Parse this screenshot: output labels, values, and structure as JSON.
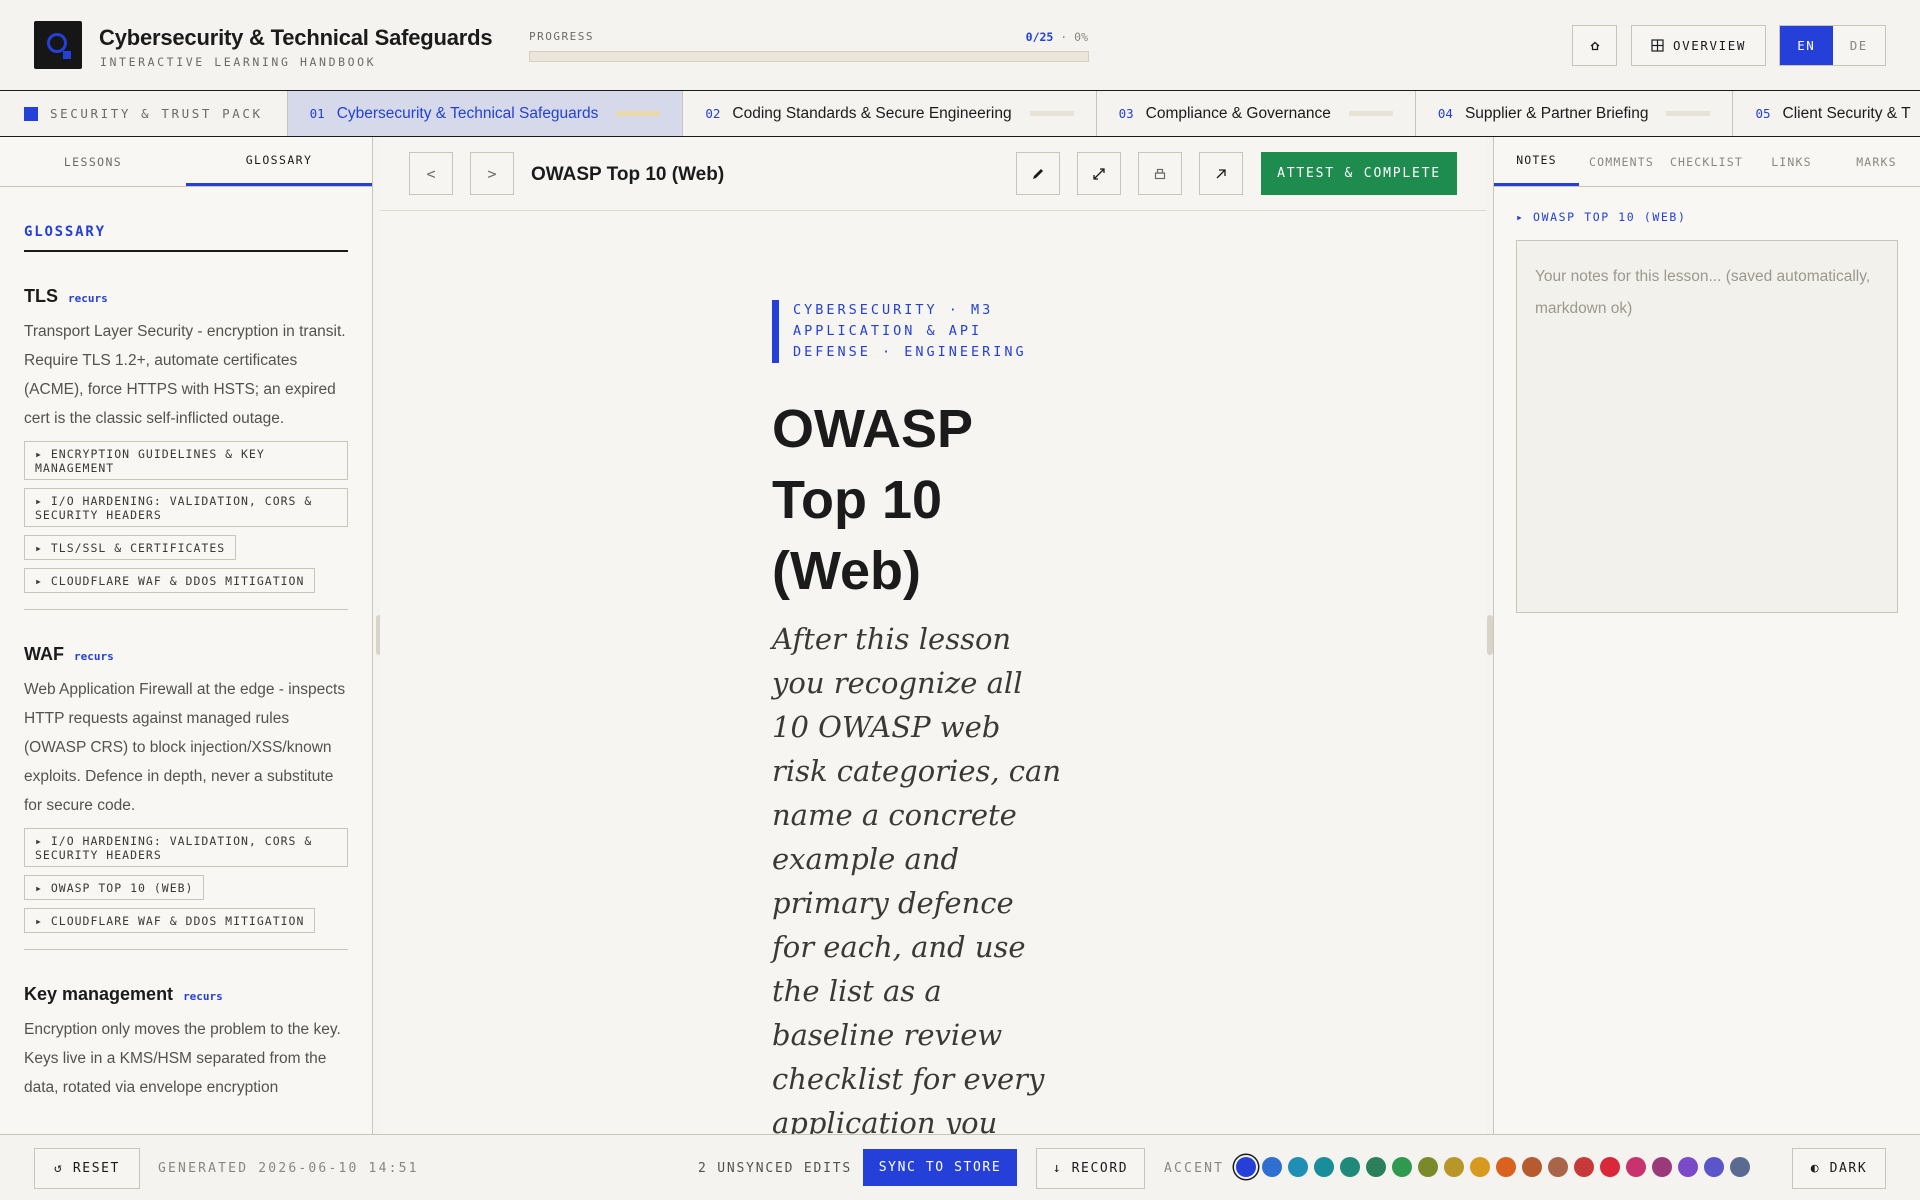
{
  "header": {
    "title": "Cybersecurity & Technical Safeguards",
    "subtitle": "INTERACTIVE LEARNING HANDBOOK",
    "progress_label": "PROGRESS",
    "progress_count": "0/25",
    "progress_pct": "· 0%",
    "progress_value": 0,
    "home_icon": "home-icon",
    "overview_label": "OVERVIEW",
    "lang_en": "EN",
    "lang_de": "DE"
  },
  "module_tabs": {
    "pack_label": "SECURITY & TRUST PACK",
    "items": [
      {
        "num": "01",
        "label": "Cybersecurity & Technical Safeguards",
        "active": true
      },
      {
        "num": "02",
        "label": "Coding Standards & Secure Engineering",
        "active": false
      },
      {
        "num": "03",
        "label": "Compliance & Governance",
        "active": false
      },
      {
        "num": "04",
        "label": "Supplier & Partner Briefing",
        "active": false
      },
      {
        "num": "05",
        "label": "Client Security & T",
        "active": false
      }
    ]
  },
  "left": {
    "tab_lessons": "LESSONS",
    "tab_glossary": "GLOSSARY",
    "heading": "GLOSSARY",
    "recurs": "recurs",
    "entries": [
      {
        "term": "TLS",
        "def": "Transport Layer Security - encryption in transit. Require TLS 1.2+, automate certificates (ACME), force HTTPS with HSTS; an expired cert is the classic self-inflicted outage.",
        "links": [
          "▸ ENCRYPTION GUIDELINES & KEY MANAGEMENT",
          "▸ I/O HARDENING: VALIDATION, CORS & SECURITY HEADERS",
          "▸ TLS/SSL & CERTIFICATES",
          "▸ CLOUDFLARE WAF & DDOS MITIGATION"
        ]
      },
      {
        "term": "WAF",
        "def": "Web Application Firewall at the edge - inspects HTTP requests against managed rules (OWASP CRS) to block injection/XSS/known exploits. Defence in depth, never a substitute for secure code.",
        "links": [
          "▸ I/O HARDENING: VALIDATION, CORS & SECURITY HEADERS",
          "▸ OWASP TOP 10 (WEB)",
          "▸ CLOUDFLARE WAF & DDOS MITIGATION"
        ]
      },
      {
        "term": "Key management",
        "def": "Encryption only moves the problem to the key. Keys live in a KMS/HSM separated from the data, rotated via envelope encryption",
        "links": []
      }
    ]
  },
  "center": {
    "prev": "<",
    "next": ">",
    "lesson_title": "OWASP Top 10 (Web)",
    "attest_label": "ATTEST & COMPLETE",
    "crumb": "CYBERSECURITY · M3 APPLICATION & API DEFENSE · ENGINEERING",
    "big_title": "OWASP Top 10 (Web)",
    "lede": "After this lesson you recognize all 10 OWASP web risk categories, can name a concrete example and primary defence for each, and use the list as a baseline review checklist for every application you"
  },
  "right": {
    "tabs": [
      "NOTES",
      "COMMENTS",
      "CHECKLIST",
      "LINKS",
      "MARKS"
    ],
    "notes_for": "▸ OWASP TOP 10 (WEB)",
    "notes_placeholder": "Your notes for this lesson... (saved automatically, markdown ok)"
  },
  "footer": {
    "reset_label": "↺ RESET",
    "generated": "GENERATED 2026-06-10 14:51",
    "unsynced": "2 UNSYNCED EDITS",
    "sync_label": "SYNC TO STORE",
    "record_label": "↓ RECORD",
    "accent_label": "ACCENT",
    "dark_label": "◐ DARK",
    "accent_colors": [
      "#2440d8",
      "#2f6fd0",
      "#1f8fb5",
      "#1a8d9a",
      "#1f8a7a",
      "#2b7f5a",
      "#2f9a4f",
      "#7a8a2a",
      "#b8962a",
      "#d89a1e",
      "#d8621e",
      "#b85a30",
      "#a8654a",
      "#c83a3a",
      "#d8283a",
      "#c8336e",
      "#9a3a7a",
      "#7a4ac8",
      "#5a55c8",
      "#5a6a90"
    ]
  }
}
